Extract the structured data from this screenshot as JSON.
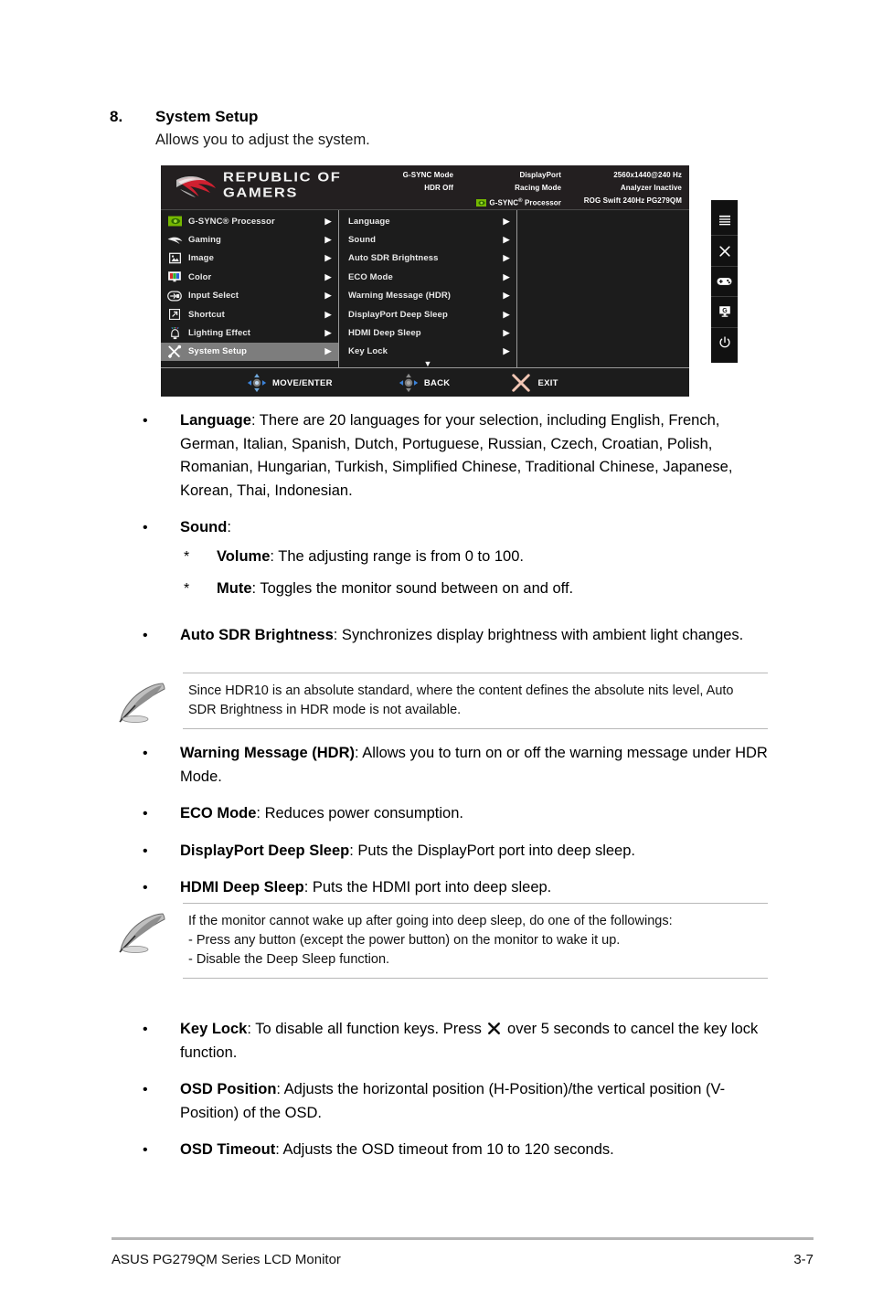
{
  "section": {
    "number": "8.",
    "title": "System Setup",
    "subtitle": "Allows you to adjust the system."
  },
  "osd": {
    "logo": {
      "line1": "REPUBLIC OF",
      "line2": "GAMERS",
      "icon": "rog-eye-logo"
    },
    "status": {
      "col1": [
        "G-SYNC Mode",
        "HDR Off"
      ],
      "col2": [
        "DisplayPort",
        "Racing Mode",
        "G-SYNC® Processor"
      ],
      "col3": [
        "2560x1440@240 Hz",
        "Analyzer Inactive",
        "ROG Swift 240Hz PG279QM"
      ]
    },
    "left_menu": [
      {
        "label": "G-SYNC® Processor",
        "icon": "nvidia-icon",
        "selected": false
      },
      {
        "label": "Gaming",
        "icon": "rog-icon",
        "selected": false
      },
      {
        "label": "Image",
        "icon": "image-icon",
        "selected": false
      },
      {
        "label": "Color",
        "icon": "color-monitor-icon",
        "selected": false
      },
      {
        "label": "Input Select",
        "icon": "input-arrow-icon",
        "selected": false
      },
      {
        "label": "Shortcut",
        "icon": "shortcut-arrow-icon",
        "selected": false
      },
      {
        "label": "Lighting Effect",
        "icon": "lighting-lamp-icon",
        "selected": false
      },
      {
        "label": "System Setup",
        "icon": "tools-icon",
        "selected": true
      }
    ],
    "sub_menu": [
      "Language",
      "Sound",
      "Auto SDR Brightness",
      "ECO Mode",
      "Warning Message (HDR)",
      "DisplayPort Deep Sleep",
      "HDMI Deep Sleep",
      "Key Lock"
    ],
    "sub_menu_has_more": true,
    "nav": [
      {
        "label": "MOVE/ENTER",
        "icon": "joystick-4way-icon"
      },
      {
        "label": "BACK",
        "icon": "joystick-left-right-icon"
      },
      {
        "label": "EXIT",
        "icon": "close-x-icon"
      }
    ],
    "colors": {
      "panel_bg": "#1c1c1c",
      "header_bg": "#231f20",
      "highlight": "#7d7d7d",
      "text": "#e8e8e8",
      "nvidia_green": "#76b900",
      "rog_red": "#cf2030",
      "exit_x": "#f2c6b4"
    },
    "buttons": [
      "menu-hamburger-icon",
      "close-x-icon",
      "gamepad-icon",
      "gamevisual-g-icon",
      "power-icon"
    ]
  },
  "bullets": [
    {
      "term": "Language",
      "text": ": There are 20 languages for your selection, including English, French, German, Italian, Spanish, Dutch, Portuguese, Russian, Czech, Croatian, Polish, Romanian, Hungarian, Turkish, Simplified Chinese, Traditional Chinese, Japanese, Korean, Thai, Indonesian."
    },
    {
      "term": "Sound",
      "text": ":",
      "sub": [
        {
          "term": "Volume",
          "text": ": The adjusting range is from 0 to 100."
        },
        {
          "term": "Mute",
          "text": ": Toggles the monitor sound between on and off."
        }
      ]
    },
    {
      "term": "Auto SDR Brightness",
      "text": ": Synchronizes display brightness with ambient light changes."
    },
    {
      "term": "Warning Message (HDR)",
      "text": ": Allows you to turn on or off the warning message under HDR Mode."
    },
    {
      "term": "ECO Mode",
      "text": ": Reduces power consumption."
    },
    {
      "term": "DisplayPort Deep Sleep",
      "text": ": Puts the DisplayPort port into deep sleep."
    },
    {
      "term": "HDMI Deep Sleep",
      "text": ": Puts the HDMI port into deep sleep."
    },
    {
      "term": "Key Lock",
      "text_before": ": To disable all function keys. Press ",
      "text_after": " over 5 seconds to cancel the key lock function."
    },
    {
      "term": "OSD Position",
      "text": ": Adjusts the horizontal position (H-Position)/the vertical position (V-Position) of the OSD."
    },
    {
      "term": "OSD Timeout",
      "text": ": Adjusts the OSD timeout from 10 to 120 seconds."
    }
  ],
  "notes": {
    "note1": "Since HDR10 is an absolute standard, where the content defines the absolute nits level, Auto SDR Brightness in HDR mode is not available.",
    "note2_line1": "If the monitor cannot wake up after going into deep sleep, do one of the followings:",
    "note2_line2": "- Press any button (except the power button) on the monitor to wake it up.",
    "note2_line3": "- Disable the Deep Sleep function."
  },
  "footer": {
    "left": "ASUS PG279QM Series LCD Monitor",
    "right": "3-7"
  },
  "markers": {
    "bullet_dot": "•",
    "star": "*",
    "arrow_right": "▶",
    "arrow_down": "▼"
  }
}
